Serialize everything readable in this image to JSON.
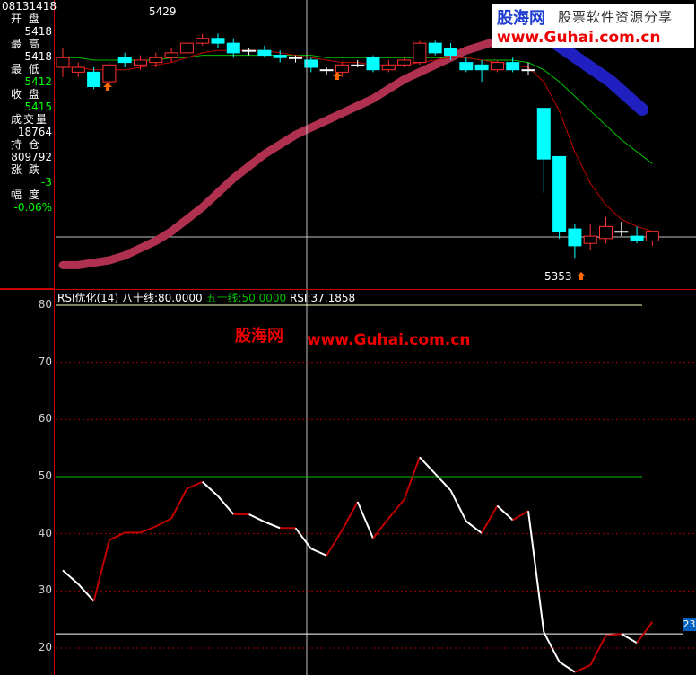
{
  "info_panel": {
    "date": "08131418",
    "rows": [
      {
        "label": "开 盘",
        "value": "5418",
        "color": "#ffffff"
      },
      {
        "label": "最 高",
        "value": "5418",
        "color": "#ffffff"
      },
      {
        "label": "最 低",
        "value": "5412",
        "color": "#00ff00"
      },
      {
        "label": "收 盘",
        "value": "5415",
        "color": "#00ff00"
      },
      {
        "label": "成交量",
        "value": "18764",
        "color": "#ffffff"
      },
      {
        "label": "持 仓",
        "value": "809792",
        "color": "#ffffff"
      },
      {
        "label": "涨 跌",
        "value": "-3",
        "color": "#00ff00"
      },
      {
        "label": "幅 度",
        "value": "-0.06%",
        "color": "#00ff00"
      }
    ]
  },
  "price_labels": {
    "high": "5429",
    "low": "5353"
  },
  "rsi_header": {
    "name": "RSI优化(14)",
    "line80": "八十线:80.0000",
    "line50": "五十线:50.0000",
    "rsi": "RSI:37.1858"
  },
  "watermark": {
    "site_cn": "股海网",
    "slogan": "股票软件资源分享",
    "url": "www.Guhai.com.cn",
    "mid_cn": "股海网",
    "mid_url": "www.Guhai.com.cn"
  },
  "right_tag": "23",
  "colors": {
    "up": "#ff3030",
    "down": "#00ffff",
    "ma_fast": "#c00000",
    "ma_slow": "#00c000",
    "band": "#b03050",
    "band2": "#2020c0",
    "rsi_up": "#c00000",
    "rsi_down": "#ffffff",
    "line50": "#00c000",
    "line80": "#ffffc0"
  },
  "chart_data": [
    {
      "type": "candlestick",
      "title": "",
      "candles": [
        {
          "o": 5432,
          "c": 5436,
          "h": 5440,
          "l": 5428
        },
        {
          "o": 5430,
          "c": 5432,
          "h": 5434,
          "l": 5428
        },
        {
          "o": 5430,
          "c": 5424,
          "h": 5432,
          "l": 5423
        },
        {
          "o": 5426,
          "c": 5433,
          "h": 5434,
          "l": 5424
        },
        {
          "o": 5436,
          "c": 5434,
          "h": 5438,
          "l": 5432
        },
        {
          "o": 5433,
          "c": 5435,
          "h": 5437,
          "l": 5431
        },
        {
          "o": 5434,
          "c": 5436,
          "h": 5438,
          "l": 5432
        },
        {
          "o": 5436,
          "c": 5438,
          "h": 5440,
          "l": 5434
        },
        {
          "o": 5438,
          "c": 5442,
          "h": 5443,
          "l": 5436
        },
        {
          "o": 5442,
          "c": 5444,
          "h": 5446,
          "l": 5441
        },
        {
          "o": 5444,
          "c": 5442,
          "h": 5446,
          "l": 5440
        },
        {
          "o": 5442,
          "c": 5438,
          "h": 5444,
          "l": 5436
        },
        {
          "o": 5439,
          "c": 5439,
          "h": 5440,
          "l": 5437
        },
        {
          "o": 5439,
          "c": 5437,
          "h": 5441,
          "l": 5436
        },
        {
          "o": 5437,
          "c": 5436,
          "h": 5439,
          "l": 5434
        },
        {
          "o": 5436,
          "c": 5436,
          "h": 5437,
          "l": 5434
        },
        {
          "o": 5435,
          "c": 5432,
          "h": 5436,
          "l": 5430
        },
        {
          "o": 5431,
          "c": 5431,
          "h": 5432,
          "l": 5429
        },
        {
          "o": 5430,
          "c": 5433,
          "h": 5434,
          "l": 5428
        },
        {
          "o": 5433,
          "c": 5433,
          "h": 5435,
          "l": 5432
        },
        {
          "o": 5436,
          "c": 5431,
          "h": 5437,
          "l": 5430
        },
        {
          "o": 5431,
          "c": 5433,
          "h": 5435,
          "l": 5430
        },
        {
          "o": 5433,
          "c": 5435,
          "h": 5436,
          "l": 5432
        },
        {
          "o": 5434,
          "c": 5442,
          "h": 5443,
          "l": 5433
        },
        {
          "o": 5442,
          "c": 5438,
          "h": 5443,
          "l": 5437
        },
        {
          "o": 5440,
          "c": 5437,
          "h": 5442,
          "l": 5435
        },
        {
          "o": 5434,
          "c": 5431,
          "h": 5436,
          "l": 5430
        },
        {
          "o": 5433,
          "c": 5431,
          "h": 5435,
          "l": 5426
        },
        {
          "o": 5431,
          "c": 5434,
          "h": 5435,
          "l": 5430
        },
        {
          "o": 5434,
          "c": 5431,
          "h": 5436,
          "l": 5430
        },
        {
          "o": 5431,
          "c": 5431,
          "h": 5434,
          "l": 5429
        },
        {
          "o": 5415,
          "c": 5394,
          "h": 5415,
          "l": 5380
        },
        {
          "o": 5395,
          "c": 5364,
          "h": 5395,
          "l": 5361
        },
        {
          "o": 5365,
          "c": 5358,
          "h": 5367,
          "l": 5353
        },
        {
          "o": 5359,
          "c": 5362,
          "h": 5367,
          "l": 5356
        },
        {
          "o": 5361,
          "c": 5366,
          "h": 5370,
          "l": 5359
        },
        {
          "o": 5364,
          "c": 5364,
          "h": 5368,
          "l": 5362
        },
        {
          "o": 5362,
          "c": 5360,
          "h": 5366,
          "l": 5359
        },
        {
          "o": 5360,
          "c": 5364,
          "h": 5364,
          "l": 5358
        }
      ],
      "ma_fast": [
        5432,
        5432,
        5431,
        5431,
        5431,
        5432,
        5433,
        5434,
        5436,
        5438,
        5439,
        5439,
        5439,
        5439,
        5438,
        5437,
        5436,
        5435,
        5434,
        5434,
        5433,
        5433,
        5433,
        5434,
        5435,
        5436,
        5436,
        5435,
        5434,
        5433,
        5432,
        5426,
        5414,
        5397,
        5384,
        5375,
        5369,
        5366,
        5364
      ],
      "ma_slow": [
        5436,
        5436,
        5435,
        5435,
        5435,
        5435,
        5435,
        5436,
        5436,
        5437,
        5437,
        5437,
        5437,
        5437,
        5437,
        5437,
        5437,
        5436,
        5436,
        5436,
        5436,
        5436,
        5436,
        5436,
        5436,
        5436,
        5436,
        5435,
        5435,
        5435,
        5434,
        5431,
        5426,
        5420,
        5414,
        5408,
        5402,
        5397,
        5392
      ],
      "band": [
        5350,
        5350,
        5351,
        5352,
        5354,
        5357,
        5360,
        5364,
        5369,
        5374,
        5380,
        5386,
        5391,
        5396,
        5400,
        5404,
        5407,
        5410,
        5413,
        5416,
        5419,
        5423,
        5427,
        5430,
        5433,
        5436,
        5439,
        5441,
        5443,
        5444,
        5445
      ]
    },
    {
      "type": "line",
      "title": "",
      "ylim": [
        15,
        82
      ],
      "yticks": [
        20,
        30,
        40,
        50,
        60,
        70,
        80
      ],
      "levels": [
        {
          "name": "八十线",
          "value": 80
        },
        {
          "name": "五十线",
          "value": 50
        }
      ],
      "values": [
        33.6,
        31.2,
        28.2,
        38.9,
        40.2,
        40.2,
        41.3,
        42.7,
        47.9,
        49.1,
        46.6,
        43.4,
        43.4,
        42.1,
        41.0,
        41.0,
        37.4,
        36.2,
        40.6,
        45.6,
        39.2,
        42.7,
        46.0,
        53.4,
        50.5,
        47.6,
        42.2,
        40.1,
        44.9,
        42.4,
        44.0,
        22.8,
        17.6,
        15.8,
        17.0,
        22.2,
        22.5,
        20.9,
        24.6
      ],
      "cursor_value": 22.5
    }
  ]
}
